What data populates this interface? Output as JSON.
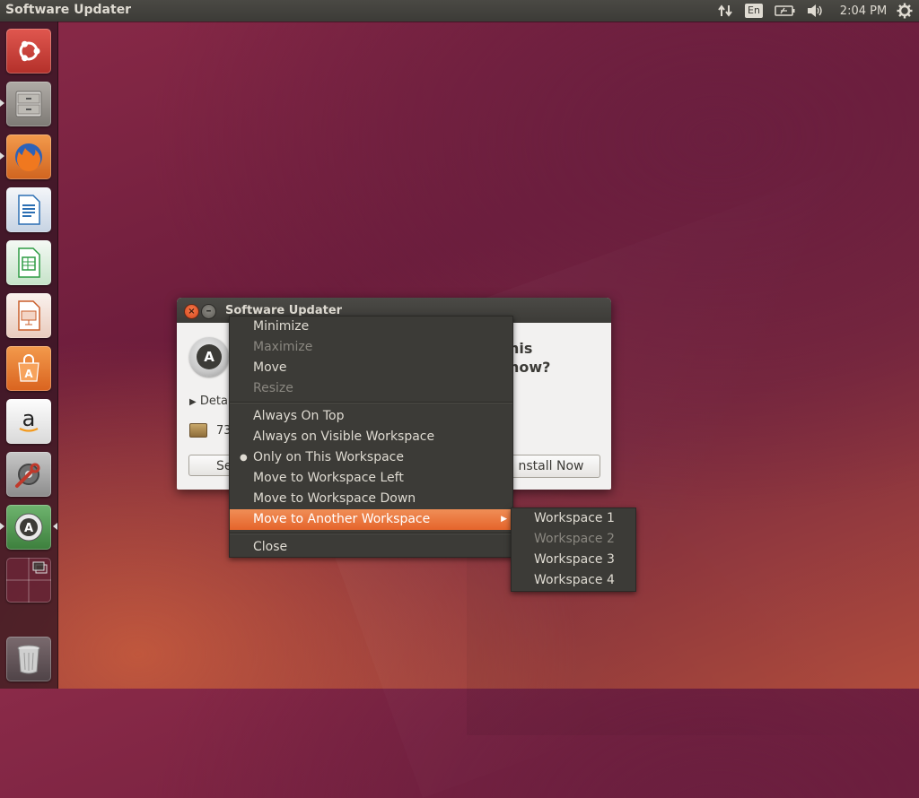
{
  "top_panel": {
    "app_title": "Software Updater",
    "language": "En",
    "clock": "2:04 PM",
    "icons": [
      "network-icon",
      "battery-icon",
      "volume-icon",
      "gear-icon"
    ]
  },
  "launcher": {
    "items": [
      {
        "name": "dash-home",
        "icon": "ubuntu-logo-icon",
        "color": "#d9534f"
      },
      {
        "name": "files",
        "icon": "file-cabinet-icon",
        "color": "#8a8a8a"
      },
      {
        "name": "firefox",
        "icon": "firefox-icon",
        "color": "#e8743b"
      },
      {
        "name": "libreoffice-writer",
        "icon": "writer-icon",
        "color": "#2c6fb3"
      },
      {
        "name": "libreoffice-calc",
        "icon": "calc-icon",
        "color": "#2d9b43"
      },
      {
        "name": "libreoffice-impress",
        "icon": "impress-icon",
        "color": "#c95d2a"
      },
      {
        "name": "software-center",
        "icon": "shopping-bag-icon",
        "color": "#e8743b"
      },
      {
        "name": "amazon",
        "icon": "amazon-icon",
        "color": "#e8e8e8"
      },
      {
        "name": "system-settings",
        "icon": "wrench-gear-icon",
        "color": "#9a9a9a"
      },
      {
        "name": "software-updater",
        "icon": "updater-icon",
        "color": "#4e9a4e"
      },
      {
        "name": "workspace-switcher",
        "icon": "workspace-grid-icon",
        "color": "#6b2a3c"
      },
      {
        "name": "trash",
        "icon": "trash-icon",
        "color": "#b0b0b0"
      }
    ]
  },
  "dialog": {
    "title": "Software Updater",
    "heading_line1": "his",
    "heading_line2": "now?",
    "details_label": "Deta",
    "size_text": "73",
    "settings_button": "Se",
    "install_button": "nstall Now"
  },
  "window_menu": {
    "items": [
      {
        "label": "Minimize",
        "enabled": true
      },
      {
        "label": "Maximize",
        "enabled": false
      },
      {
        "label": "Move",
        "enabled": true
      },
      {
        "label": "Resize",
        "enabled": false
      },
      {
        "label": "Always On Top",
        "enabled": true
      },
      {
        "label": "Always on Visible Workspace",
        "enabled": true
      },
      {
        "label": "Only on This Workspace",
        "enabled": true,
        "selected": true
      },
      {
        "label": "Move to Workspace Left",
        "enabled": true
      },
      {
        "label": "Move to Workspace Down",
        "enabled": true
      },
      {
        "label": "Move to Another Workspace",
        "enabled": true,
        "highlighted": true,
        "submenu": true
      },
      {
        "label": "Close",
        "enabled": true
      }
    ]
  },
  "workspace_submenu": {
    "items": [
      {
        "label": "Workspace 1",
        "enabled": true
      },
      {
        "label": "Workspace 2",
        "enabled": false
      },
      {
        "label": "Workspace 3",
        "enabled": true
      },
      {
        "label": "Workspace 4",
        "enabled": true
      }
    ]
  },
  "colors": {
    "panel": "#3c3b37",
    "menu_highlight": "#e5642b",
    "text": "#dfdbd2"
  }
}
